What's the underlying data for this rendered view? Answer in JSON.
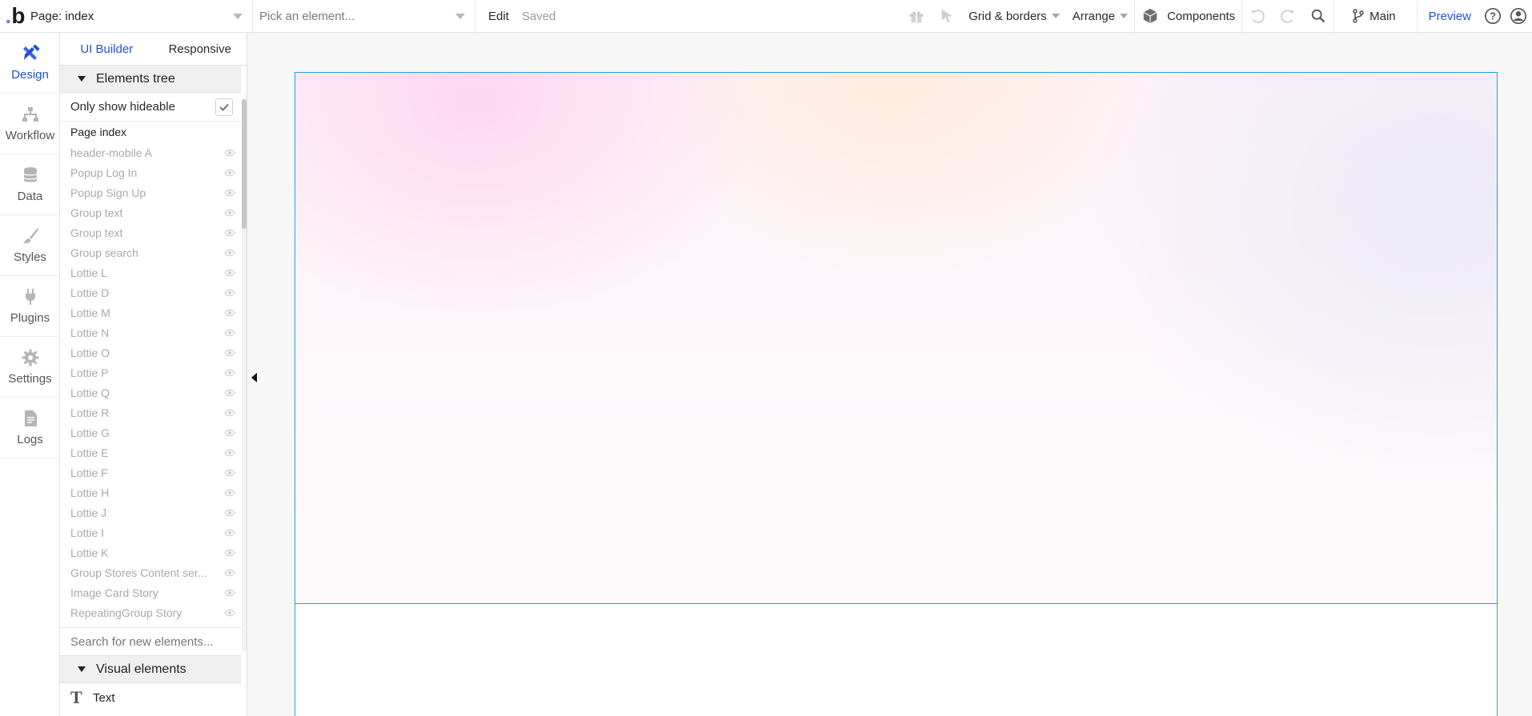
{
  "topbar": {
    "page_select": "Page: index",
    "element_select": "Pick an element...",
    "edit": "Edit",
    "status": "Saved",
    "grid_borders": "Grid & borders",
    "arrange": "Arrange",
    "components": "Components",
    "branch": "Main",
    "preview": "Preview"
  },
  "rail": {
    "items": [
      {
        "label": "Design",
        "icon": "design-icon"
      },
      {
        "label": "Workflow",
        "icon": "workflow-icon"
      },
      {
        "label": "Data",
        "icon": "database-icon"
      },
      {
        "label": "Styles",
        "icon": "brush-icon"
      },
      {
        "label": "Plugins",
        "icon": "plug-icon"
      },
      {
        "label": "Settings",
        "icon": "gear-icon"
      },
      {
        "label": "Logs",
        "icon": "document-icon"
      }
    ]
  },
  "panel": {
    "tabs": [
      "UI Builder",
      "Responsive"
    ],
    "elements_tree_title": "Elements tree",
    "only_show_hideable": "Only show hideable",
    "root": "Page index",
    "tree": [
      "header-mobile A",
      "Popup Log In",
      "Popup Sign Up",
      "Group text",
      "Group text",
      "Group search",
      "Lottie L",
      "Lottie D",
      "Lottie M",
      "Lottie N",
      "Lottie O",
      "Lottie P",
      "Lottie Q",
      "Lottie R",
      "Lottie G",
      "Lottie E",
      "Lottie F",
      "Lottie H",
      "Lottie J",
      "Lottie I",
      "Lottie K",
      "Group Stores Content ser...",
      "Image Card Story",
      "RepeatingGroup Story"
    ],
    "search_placeholder": "Search for new elements...",
    "visual_elements_title": "Visual elements",
    "text_element": "Text"
  },
  "colors": {
    "accent": "#2150d1",
    "canvas_border": "#2a9fd6"
  }
}
